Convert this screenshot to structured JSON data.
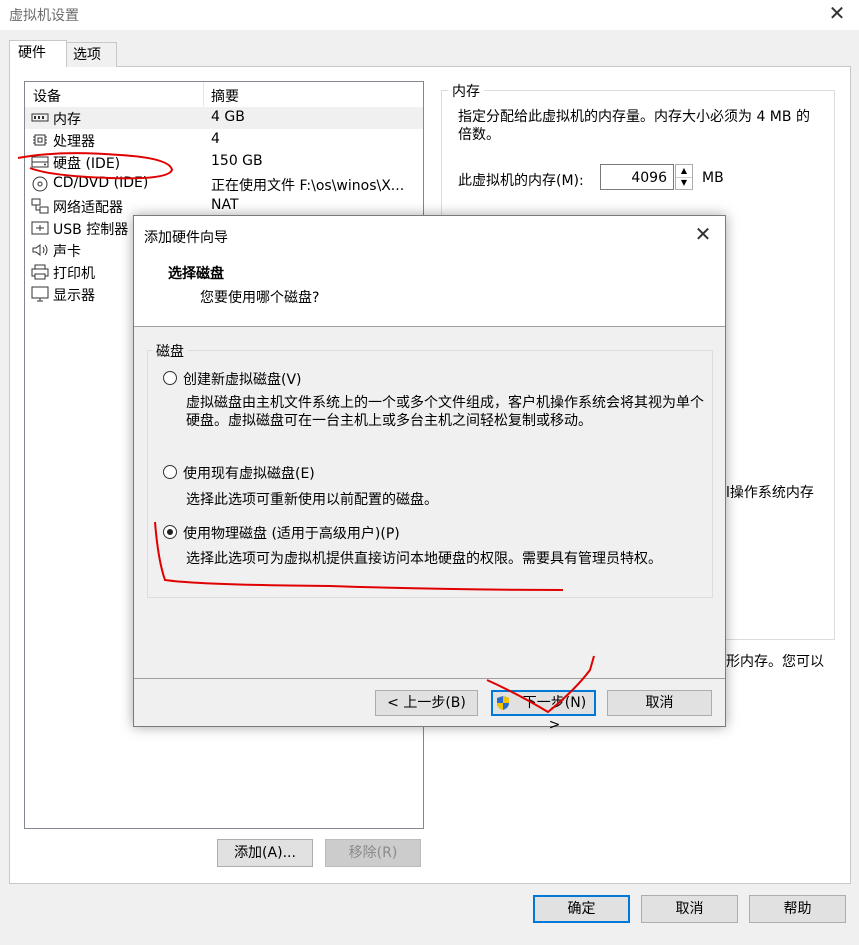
{
  "window": {
    "title": "虚拟机设置",
    "close_glyph": "✕",
    "tabs": [
      {
        "label": "硬件"
      },
      {
        "label": "选项"
      }
    ]
  },
  "device_list": {
    "columns": [
      "设备",
      "摘要"
    ],
    "rows": [
      {
        "icon": "memory-icon",
        "device": "内存",
        "summary": "4 GB"
      },
      {
        "icon": "cpu-icon",
        "device": "处理器",
        "summary": "4"
      },
      {
        "icon": "hard-disk-icon",
        "device": "硬盘 (IDE)",
        "summary": "150 GB"
      },
      {
        "icon": "cd-dvd-icon",
        "device": "CD/DVD (IDE)",
        "summary": "正在使用文件 F:\\os\\winos\\X..."
      },
      {
        "icon": "network-adapter-icon",
        "device": "网络适配器",
        "summary": "NAT"
      },
      {
        "icon": "usb-icon",
        "device": "USB 控制器",
        "summary": ""
      },
      {
        "icon": "sound-icon",
        "device": "声卡",
        "summary": ""
      },
      {
        "icon": "printer-icon",
        "device": "打印机",
        "summary": ""
      },
      {
        "icon": "display-icon",
        "device": "显示器",
        "summary": ""
      }
    ],
    "add_button": "添加(A)...",
    "remove_button": "移除(R)"
  },
  "memory": {
    "group_title": "内存",
    "description": "指定分配给此虚拟机的内存量。内存大小必须为 4 MB 的倍数。",
    "field_label": "此虚拟机的内存(M):",
    "value": "4096",
    "unit": "MB",
    "partial_text_1": "l操作系统内存",
    "partial_text_2": "形内存。您可以"
  },
  "footer": {
    "ok": "确定",
    "cancel": "取消",
    "help": "帮助"
  },
  "wizard": {
    "title": "添加硬件向导",
    "close_glyph": "✕",
    "heading": "选择磁盘",
    "subheading": "您要使用哪个磁盘?",
    "group_title": "磁盘",
    "options": [
      {
        "label": "创建新虚拟磁盘(V)",
        "description": "虚拟磁盘由主机文件系统上的一个或多个文件组成，客户机操作系统会将其视为单个硬盘。虚拟磁盘可在一台主机上或多台主机之间轻松复制或移动。",
        "selected": false
      },
      {
        "label": "使用现有虚拟磁盘(E)",
        "description": "选择此选项可重新使用以前配置的磁盘。",
        "selected": false
      },
      {
        "label": "使用物理磁盘 (适用于高级用户)(P)",
        "description": "选择此选项可为虚拟机提供直接访问本地硬盘的权限。需要具有管理员特权。",
        "selected": true
      }
    ],
    "back_button": "< 上一步(B)",
    "next_button": "下一步(N) >",
    "cancel_button": "取消"
  },
  "colors": {
    "accent": "#0078d7",
    "annotation": "#e00000"
  }
}
